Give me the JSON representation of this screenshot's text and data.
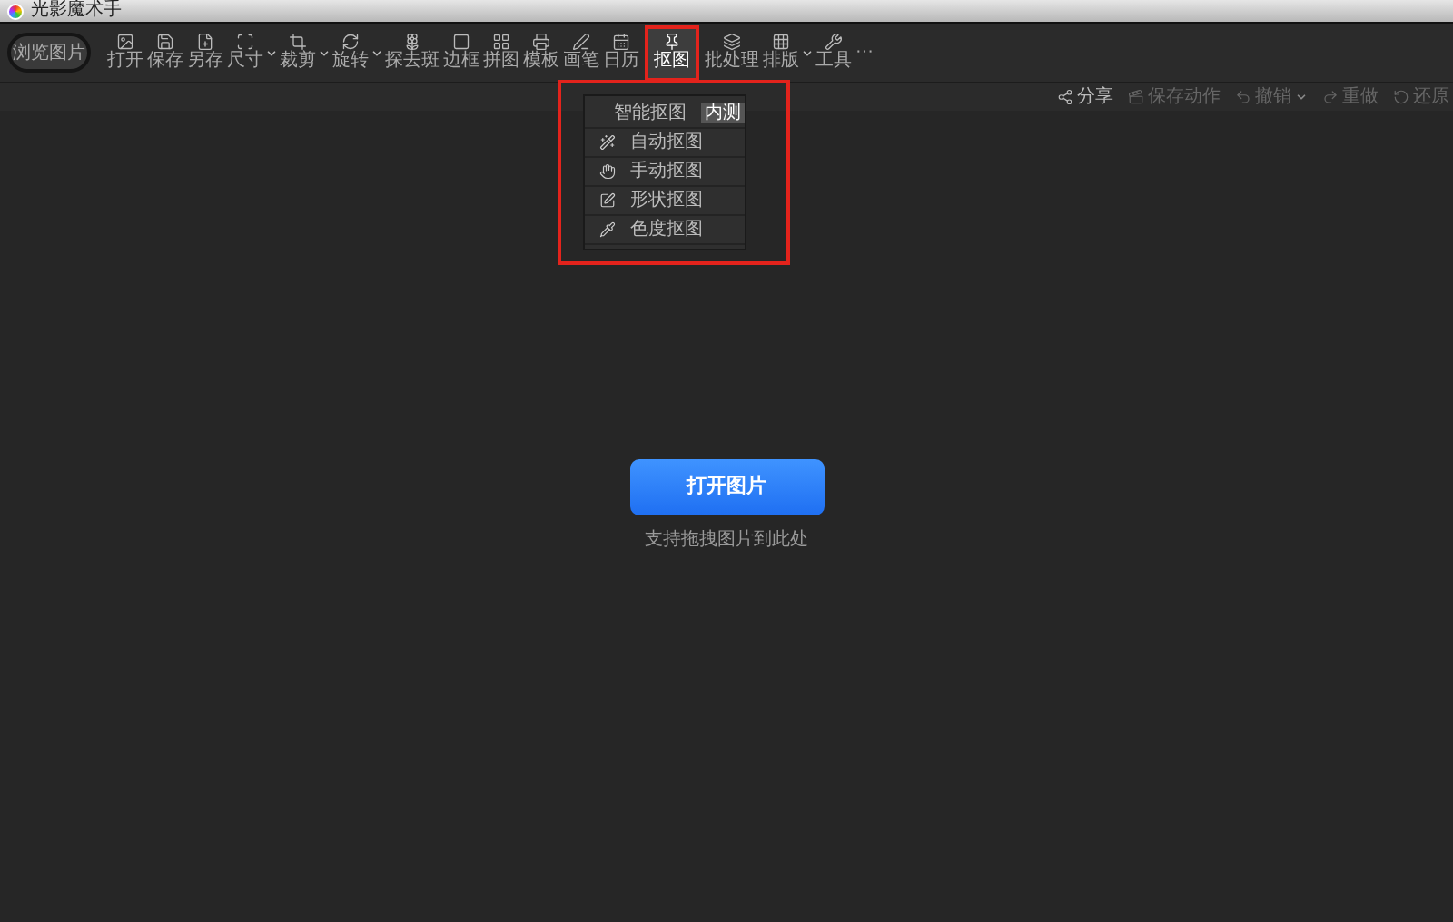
{
  "window": {
    "title": "光影魔术手"
  },
  "browse_button": "浏览图片",
  "toolbar": [
    {
      "label": "打开",
      "dropdown": false,
      "selected": false
    },
    {
      "label": "保存",
      "dropdown": false,
      "selected": false
    },
    {
      "label": "另存",
      "dropdown": false,
      "selected": false
    },
    {
      "label": "尺寸",
      "dropdown": true,
      "selected": false
    },
    {
      "label": "裁剪",
      "dropdown": true,
      "selected": false
    },
    {
      "label": "旋转",
      "dropdown": true,
      "selected": false
    },
    {
      "label": "探去斑",
      "dropdown": false,
      "selected": false
    },
    {
      "label": "边框",
      "dropdown": false,
      "selected": false
    },
    {
      "label": "拼图",
      "dropdown": false,
      "selected": false
    },
    {
      "label": "模板",
      "dropdown": false,
      "selected": false
    },
    {
      "label": "画笔",
      "dropdown": false,
      "selected": false
    },
    {
      "label": "日历",
      "dropdown": false,
      "selected": false
    },
    {
      "label": "抠图",
      "dropdown": false,
      "selected": true
    },
    {
      "label": "批处理",
      "dropdown": false,
      "selected": false
    },
    {
      "label": "排版",
      "dropdown": true,
      "selected": false
    },
    {
      "label": "工具",
      "dropdown": false,
      "selected": false
    },
    {
      "label": "···",
      "dropdown": false,
      "selected": false
    }
  ],
  "actions": [
    {
      "label": "分享",
      "dropdown": false,
      "disabled": false
    },
    {
      "label": "保存动作",
      "dropdown": false,
      "disabled": true
    },
    {
      "label": "撤销",
      "dropdown": true,
      "disabled": true
    },
    {
      "label": "重做",
      "dropdown": false,
      "disabled": true
    },
    {
      "label": "还原",
      "dropdown": false,
      "disabled": true
    }
  ],
  "cutout_menu": [
    {
      "label": "智能抠图",
      "badge": "内测"
    },
    {
      "label": "自动抠图"
    },
    {
      "label": "手动抠图"
    },
    {
      "label": "形状抠图"
    },
    {
      "label": "色度抠图"
    }
  ],
  "open_button": "打开图片",
  "drop_hint": "支持拖拽图片到此处"
}
